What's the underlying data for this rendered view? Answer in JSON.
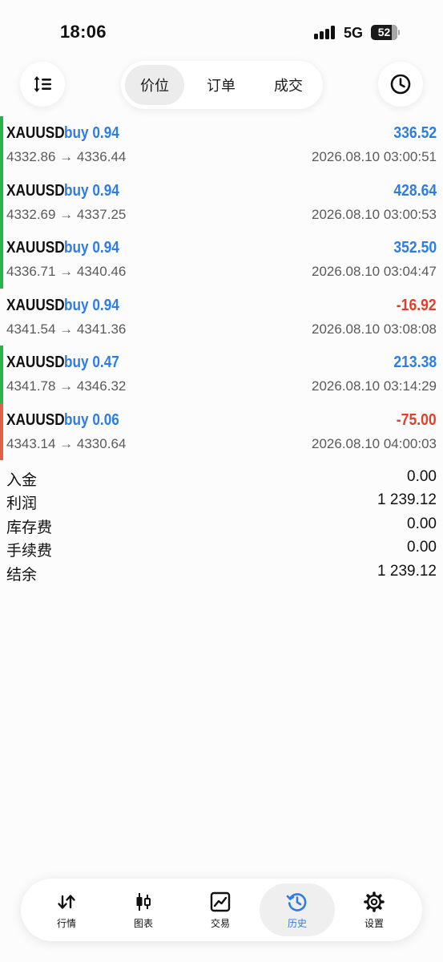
{
  "status_bar": {
    "time": "18:06",
    "network": "5G",
    "battery": "52"
  },
  "toolbar": {
    "sort_icon": "sort-arrows-icon",
    "history_icon": "clock-icon",
    "tabs": [
      {
        "label": "价位",
        "active": true
      },
      {
        "label": "订单",
        "active": false
      },
      {
        "label": "成交",
        "active": false
      }
    ]
  },
  "colors": {
    "accent": "#2f7de1",
    "loss": "#e0402a",
    "gain_bar": "#2bb14a",
    "loss_bar": "#e0604c"
  },
  "deals": [
    {
      "symbol": "XAUUSD",
      "side": "buy 0.94",
      "profit": "336.52",
      "prices": "4332.86 → 4336.44",
      "time": "2026.08.10 03:00:51",
      "positive": true,
      "bar": "green"
    },
    {
      "symbol": "XAUUSD",
      "side": "buy 0.94",
      "profit": "428.64",
      "prices": "4332.69 → 4337.25",
      "time": "2026.08.10 03:00:53",
      "positive": true,
      "bar": "green"
    },
    {
      "symbol": "XAUUSD",
      "side": "buy 0.94",
      "profit": "352.50",
      "prices": "4336.71 → 4340.46",
      "time": "2026.08.10 03:04:47",
      "positive": true,
      "bar": "green"
    },
    {
      "symbol": "XAUUSD",
      "side": "buy 0.94",
      "profit": "-16.92",
      "prices": "4341.54 → 4341.36",
      "time": "2026.08.10 03:08:08",
      "positive": false,
      "bar": "none"
    },
    {
      "symbol": "XAUUSD",
      "side": "buy 0.47",
      "profit": "213.38",
      "prices": "4341.78 → 4346.32",
      "time": "2026.08.10 03:14:29",
      "positive": true,
      "bar": "green"
    },
    {
      "symbol": "XAUUSD",
      "side": "buy 0.06",
      "profit": "-75.00",
      "prices": "4343.14 → 4330.64",
      "time": "2026.08.10 04:00:03",
      "positive": false,
      "bar": "red"
    }
  ],
  "summary": [
    {
      "label": "入金",
      "value": "0.00"
    },
    {
      "label": "利润",
      "value": "1 239.12"
    },
    {
      "label": "库存费",
      "value": "0.00"
    },
    {
      "label": "手续费",
      "value": "0.00"
    },
    {
      "label": "结余",
      "value": "1 239.12"
    }
  ],
  "tab_bar": [
    {
      "label": "行情",
      "icon": "quotes-arrows-icon",
      "active": false
    },
    {
      "label": "图表",
      "icon": "candlestick-icon",
      "active": false
    },
    {
      "label": "交易",
      "icon": "trade-chart-icon",
      "active": false
    },
    {
      "label": "历史",
      "icon": "history-clock-icon",
      "active": true
    },
    {
      "label": "设置",
      "icon": "gear-icon",
      "active": false
    }
  ]
}
